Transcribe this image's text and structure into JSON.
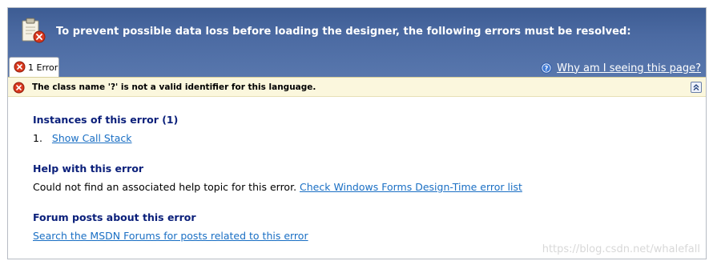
{
  "header": {
    "title": "To prevent possible data loss before loading the designer, the following errors must be resolved:",
    "icon": "clipboard-error-icon"
  },
  "tab": {
    "label": "1 Error",
    "icon": "error-icon"
  },
  "help_link": {
    "label": "Why am I seeing this page?",
    "icon": "help-icon"
  },
  "error": {
    "message": "The class name '?' is not a valid identifier for this language.",
    "icon": "error-icon",
    "collapse_icon": "collapse-chevron-up-icon"
  },
  "sections": {
    "instances": {
      "title": "Instances of this error (1)",
      "items": [
        {
          "number": "1.",
          "link": "Show Call Stack"
        }
      ]
    },
    "help": {
      "title": "Help with this error",
      "text": "Could not find an associated help topic for this error.",
      "link": "Check Windows Forms Design-Time error list"
    },
    "forum": {
      "title": "Forum posts about this error",
      "link": "Search the MSDN Forums for posts related to this error"
    }
  },
  "watermark": "https://blog.csdn.net/whalefall",
  "colors": {
    "header_bg": "#4b6aa2",
    "error_bar_bg": "#fbf7dd",
    "section_title": "#0a1f7a",
    "link": "#1a6fc4",
    "error_red": "#d9381e"
  }
}
